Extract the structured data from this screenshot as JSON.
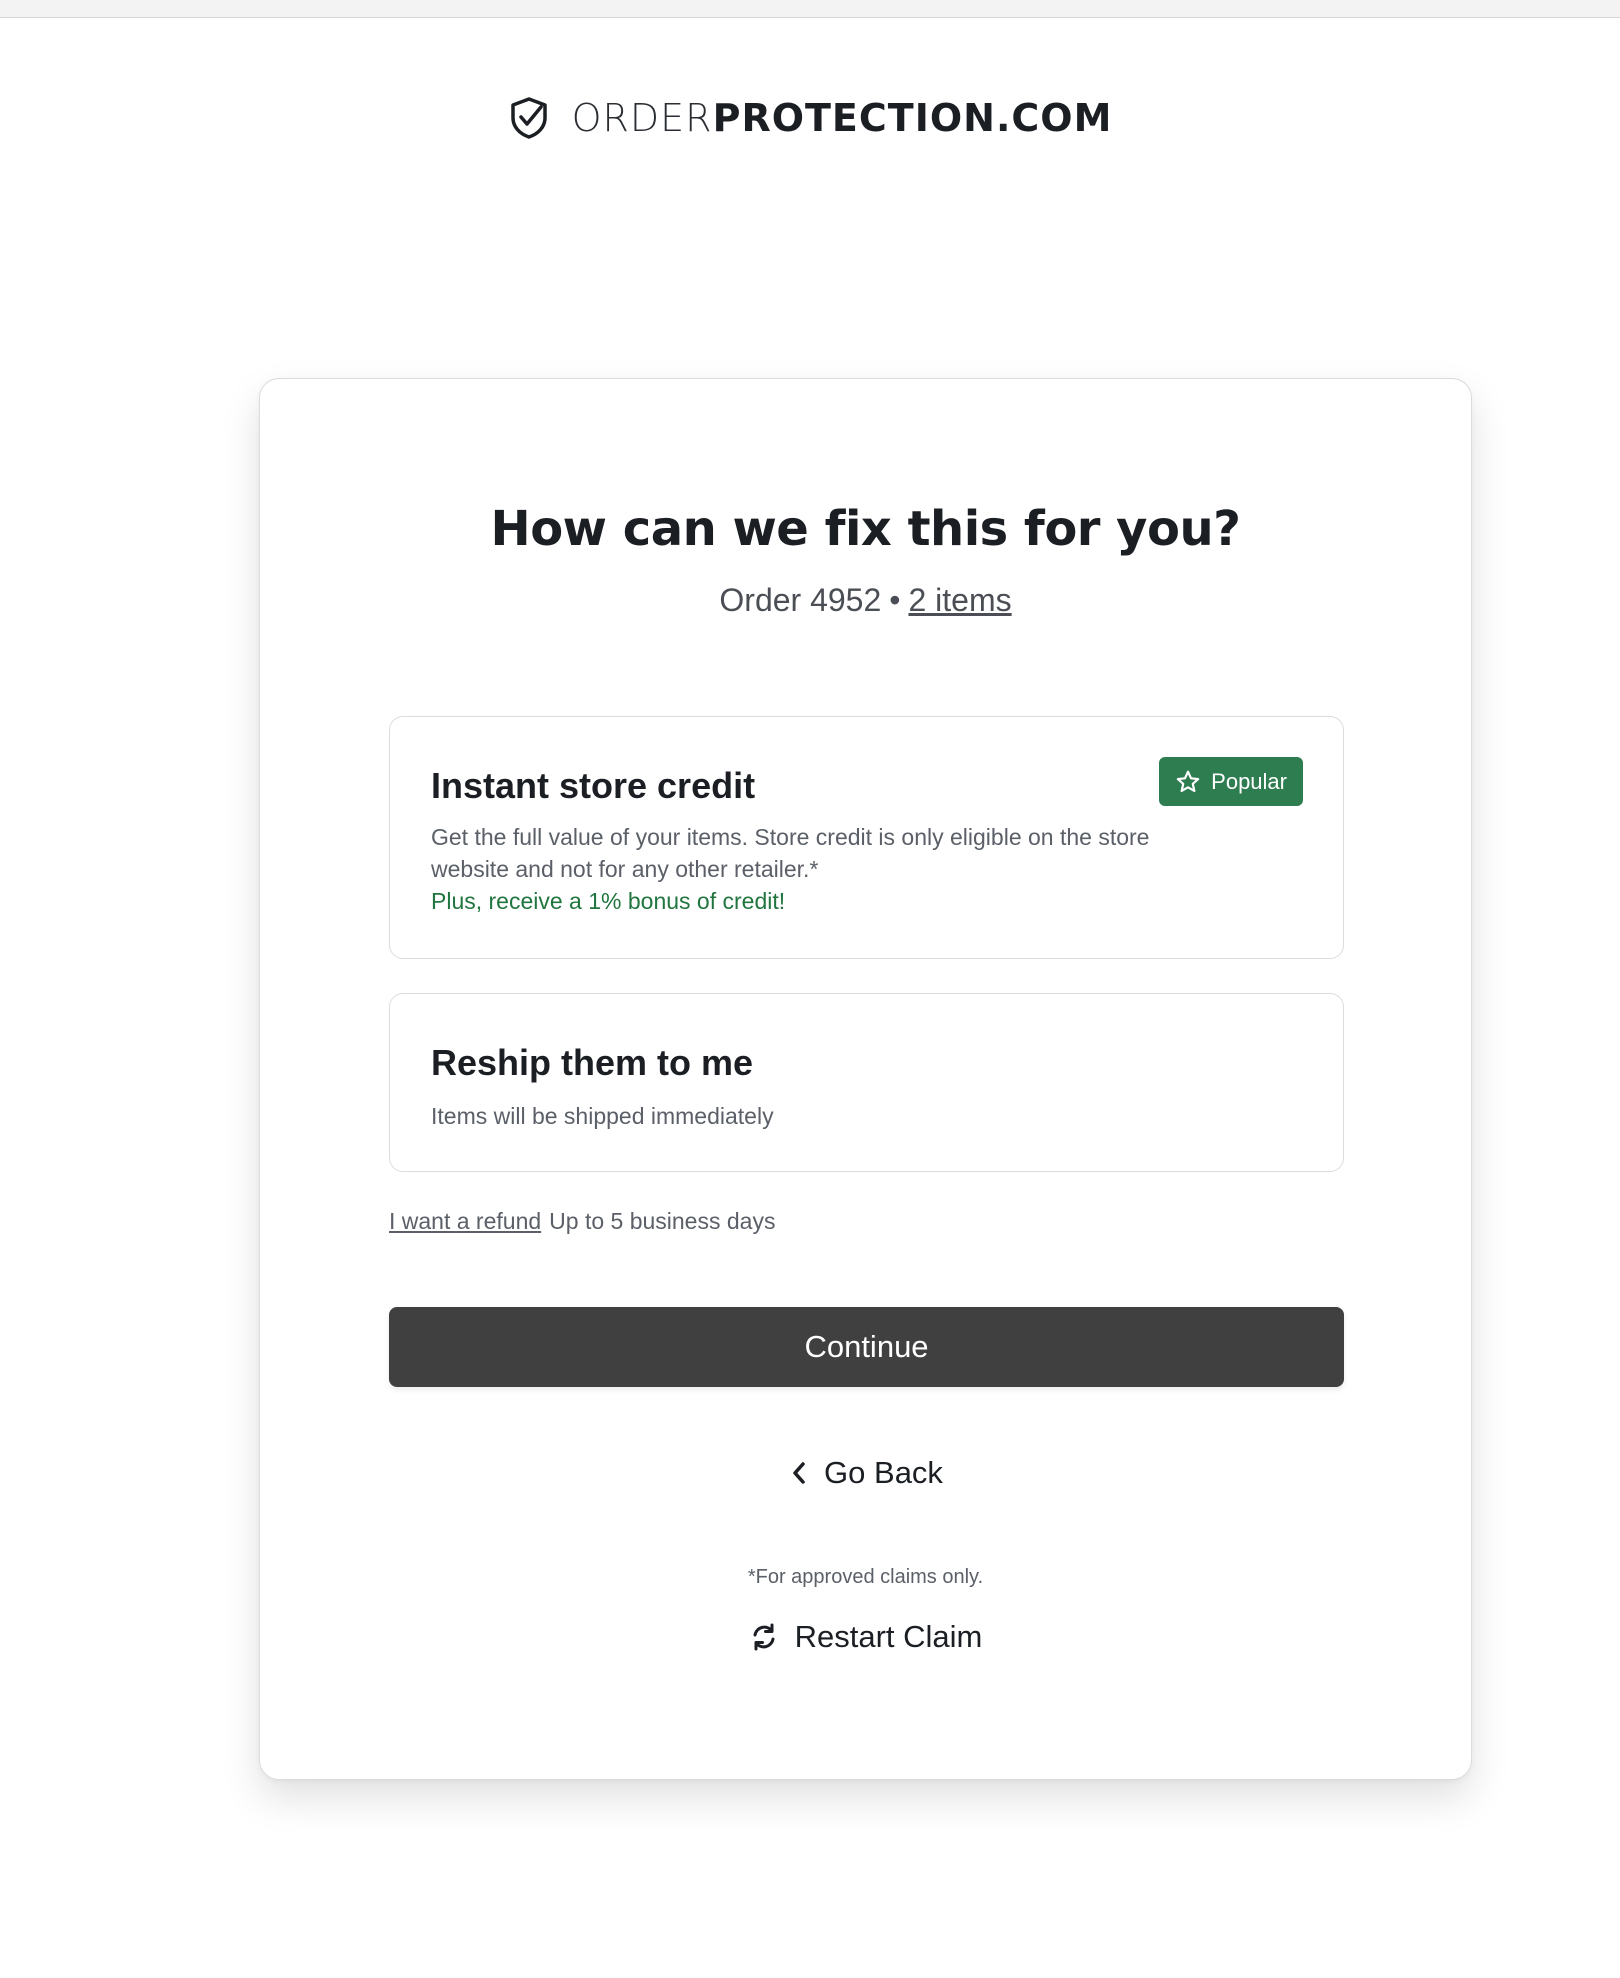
{
  "header": {
    "logo_light": "ORDER",
    "logo_bold": "PROTECTION.COM",
    "logo_icon": "shield-check-icon"
  },
  "card": {
    "title": "How can we fix this for you?",
    "order_label": "Order 4952",
    "separator": "•",
    "items_link": "2 items"
  },
  "options": [
    {
      "title": "Instant store credit",
      "description": "Get the full value of your items. Store credit is only eligible on the store website and not for any other retailer.*",
      "bonus": "Plus, receive a 1% bonus of credit!",
      "badge": "Popular",
      "badge_icon": "star-icon",
      "badge_color": "#2e7d50"
    },
    {
      "title": "Reship them to me",
      "description": "Items will be shipped immediately"
    }
  ],
  "refund": {
    "link": "I want a refund",
    "note": "Up to 5 business days"
  },
  "actions": {
    "continue": "Continue",
    "continue_color": "#404040",
    "go_back": "Go Back",
    "go_back_icon": "chevron-left-icon",
    "disclaimer": "*For approved claims only.",
    "restart": "Restart Claim",
    "restart_icon": "refresh-icon"
  }
}
